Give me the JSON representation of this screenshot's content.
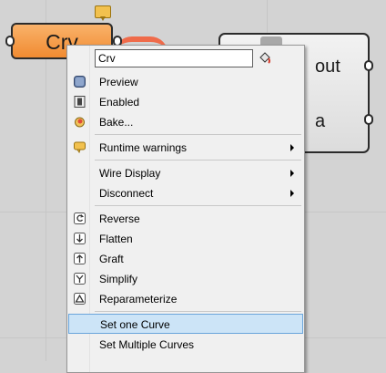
{
  "canvas": {
    "background": "#d3d3d3"
  },
  "crv_component": {
    "label": "Crv",
    "color": "#f18b31",
    "warning_icon": "warning-balloon-icon"
  },
  "right_component": {
    "outputs": [
      "out",
      "a"
    ]
  },
  "context_menu": {
    "name_value": "Crv",
    "bucket_icon": "paint-bucket-icon",
    "groups": [
      [
        {
          "label": "Preview",
          "icon": "preview-icon"
        },
        {
          "label": "Enabled",
          "icon": "enabled-icon"
        },
        {
          "label": "Bake...",
          "icon": "bake-icon"
        }
      ],
      [
        {
          "label": "Runtime warnings",
          "icon": "warning-balloon-icon",
          "submenu": true
        }
      ],
      [
        {
          "label": "Wire Display",
          "submenu": true
        },
        {
          "label": "Disconnect",
          "submenu": true
        }
      ],
      [
        {
          "label": "Reverse",
          "icon": "reverse-icon"
        },
        {
          "label": "Flatten",
          "icon": "flatten-icon"
        },
        {
          "label": "Graft",
          "icon": "graft-icon"
        },
        {
          "label": "Simplify",
          "icon": "simplify-icon"
        },
        {
          "label": "Reparameterize",
          "icon": "reparameterize-icon"
        }
      ],
      [
        {
          "label": "Set one Curve",
          "highlighted": true
        },
        {
          "label": "Set Multiple Curves"
        }
      ]
    ]
  }
}
